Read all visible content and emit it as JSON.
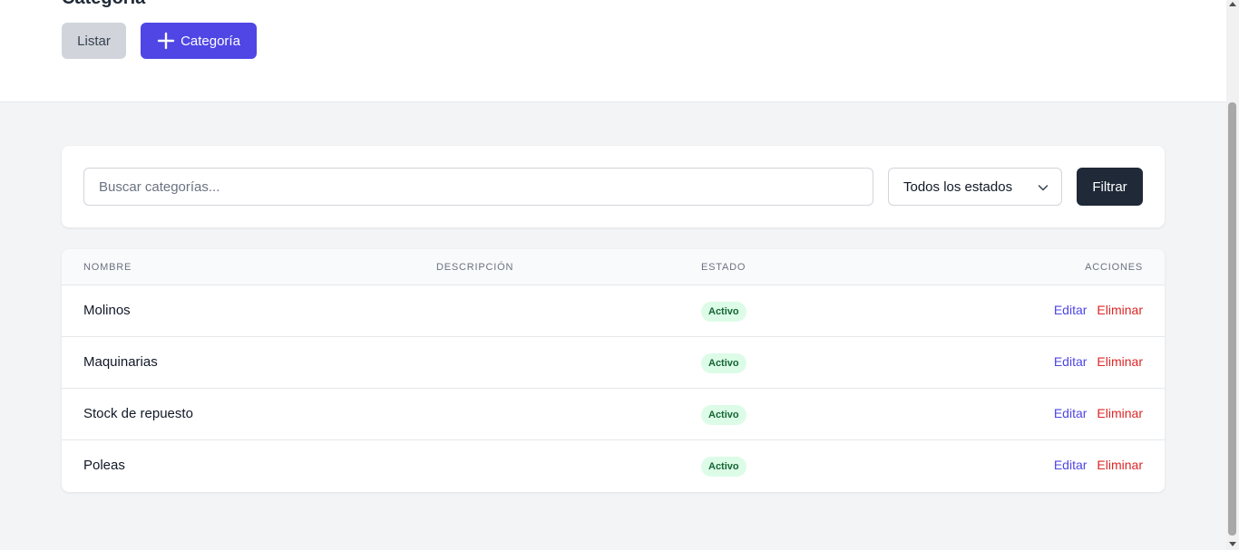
{
  "header": {
    "title": "Categoría",
    "list_button": "Listar",
    "add_button": "Categoría"
  },
  "filters": {
    "search_placeholder": "Buscar categorías...",
    "search_value": "",
    "state_selected": "Todos los estados",
    "filter_button": "Filtrar"
  },
  "table": {
    "columns": [
      "NOMBRE",
      "DESCRIPCIÓN",
      "ESTADO",
      "ACCIONES"
    ],
    "rows": [
      {
        "name": "Molinos",
        "description": "",
        "status": "Activo",
        "edit": "Editar",
        "delete": "Eliminar"
      },
      {
        "name": "Maquinarias",
        "description": "",
        "status": "Activo",
        "edit": "Editar",
        "delete": "Eliminar"
      },
      {
        "name": "Stock de repuesto",
        "description": "",
        "status": "Activo",
        "edit": "Editar",
        "delete": "Eliminar"
      },
      {
        "name": "Poleas",
        "description": "",
        "status": "Activo",
        "edit": "Editar",
        "delete": "Eliminar"
      }
    ]
  },
  "colors": {
    "primary": "#4f46e5",
    "dark_button": "#1f2937",
    "danger": "#dc2626",
    "success_bg": "#dcfce7",
    "success_text": "#166534"
  },
  "icons": {
    "add": "plus-icon",
    "select": "chevron-down-icon"
  }
}
